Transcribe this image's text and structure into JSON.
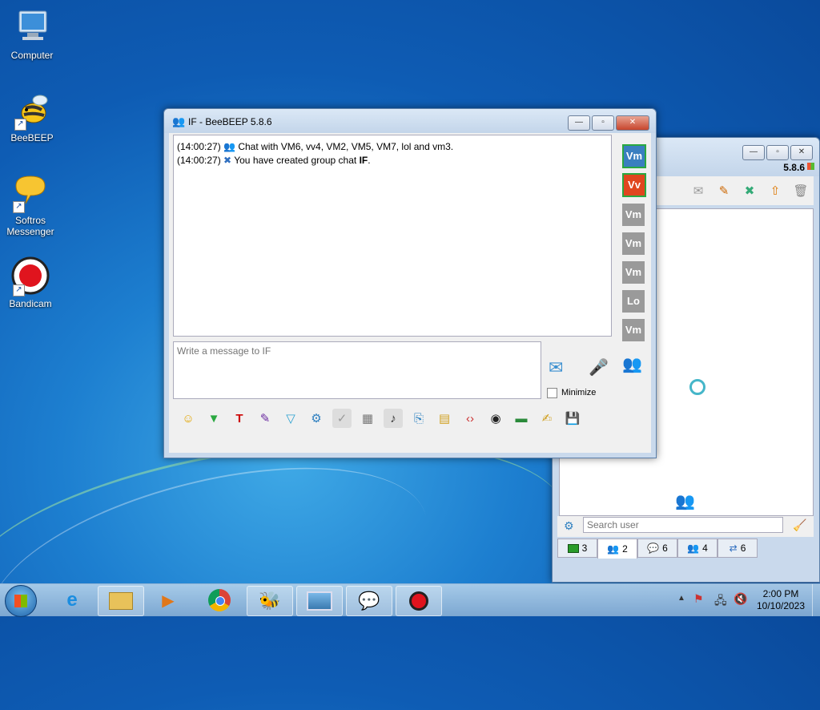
{
  "desktop": {
    "icons": [
      {
        "label": "Computer"
      },
      {
        "label": "BeeBEEP"
      },
      {
        "label": "Softros Messenger"
      },
      {
        "label": "Bandicam"
      }
    ]
  },
  "chat_window": {
    "title": "IF - BeeBEEP 5.8.6",
    "messages": [
      {
        "time": "(14:00:27)",
        "text": "Chat with VM6, vv4, VM2, VM5, VM7, lol and vm3."
      },
      {
        "time": "(14:00:27)",
        "text_prefix": "You have created group chat ",
        "bold": "IF",
        "text_suffix": "."
      }
    ],
    "input_placeholder": "Write a message to IF",
    "minimize_label": "Minimize",
    "members": [
      "Vm",
      "Vv",
      "Vm",
      "Vm",
      "Vm",
      "Lo",
      "Vm"
    ]
  },
  "main_window": {
    "version": "5.8.6",
    "search_placeholder": "Search user",
    "tabs": [
      {
        "count": "3"
      },
      {
        "count": "2"
      },
      {
        "count": "6"
      },
      {
        "count": "4"
      },
      {
        "count": "6"
      }
    ]
  },
  "taskbar": {
    "time": "2:00 PM",
    "date": "10/10/2023"
  }
}
